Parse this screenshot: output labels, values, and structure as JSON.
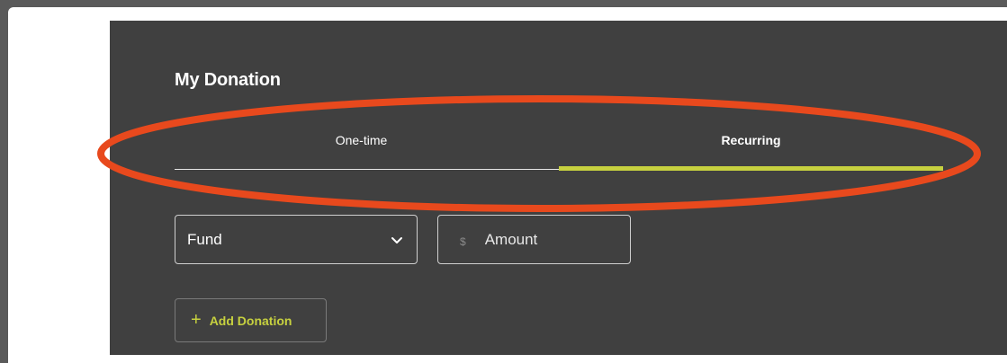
{
  "donation": {
    "title": "My Donation",
    "tabs": [
      {
        "label": "One-time",
        "active": false
      },
      {
        "label": "Recurring",
        "active": true
      }
    ],
    "fund": {
      "selected": "Fund"
    },
    "amount": {
      "currency_symbol": "$",
      "placeholder": "Amount"
    },
    "add_button": {
      "icon": "plus-icon",
      "label": "Add Donation"
    }
  },
  "colors": {
    "panel_bg": "#404040",
    "accent": "#c7d13f",
    "annotation": "#e8491d"
  }
}
